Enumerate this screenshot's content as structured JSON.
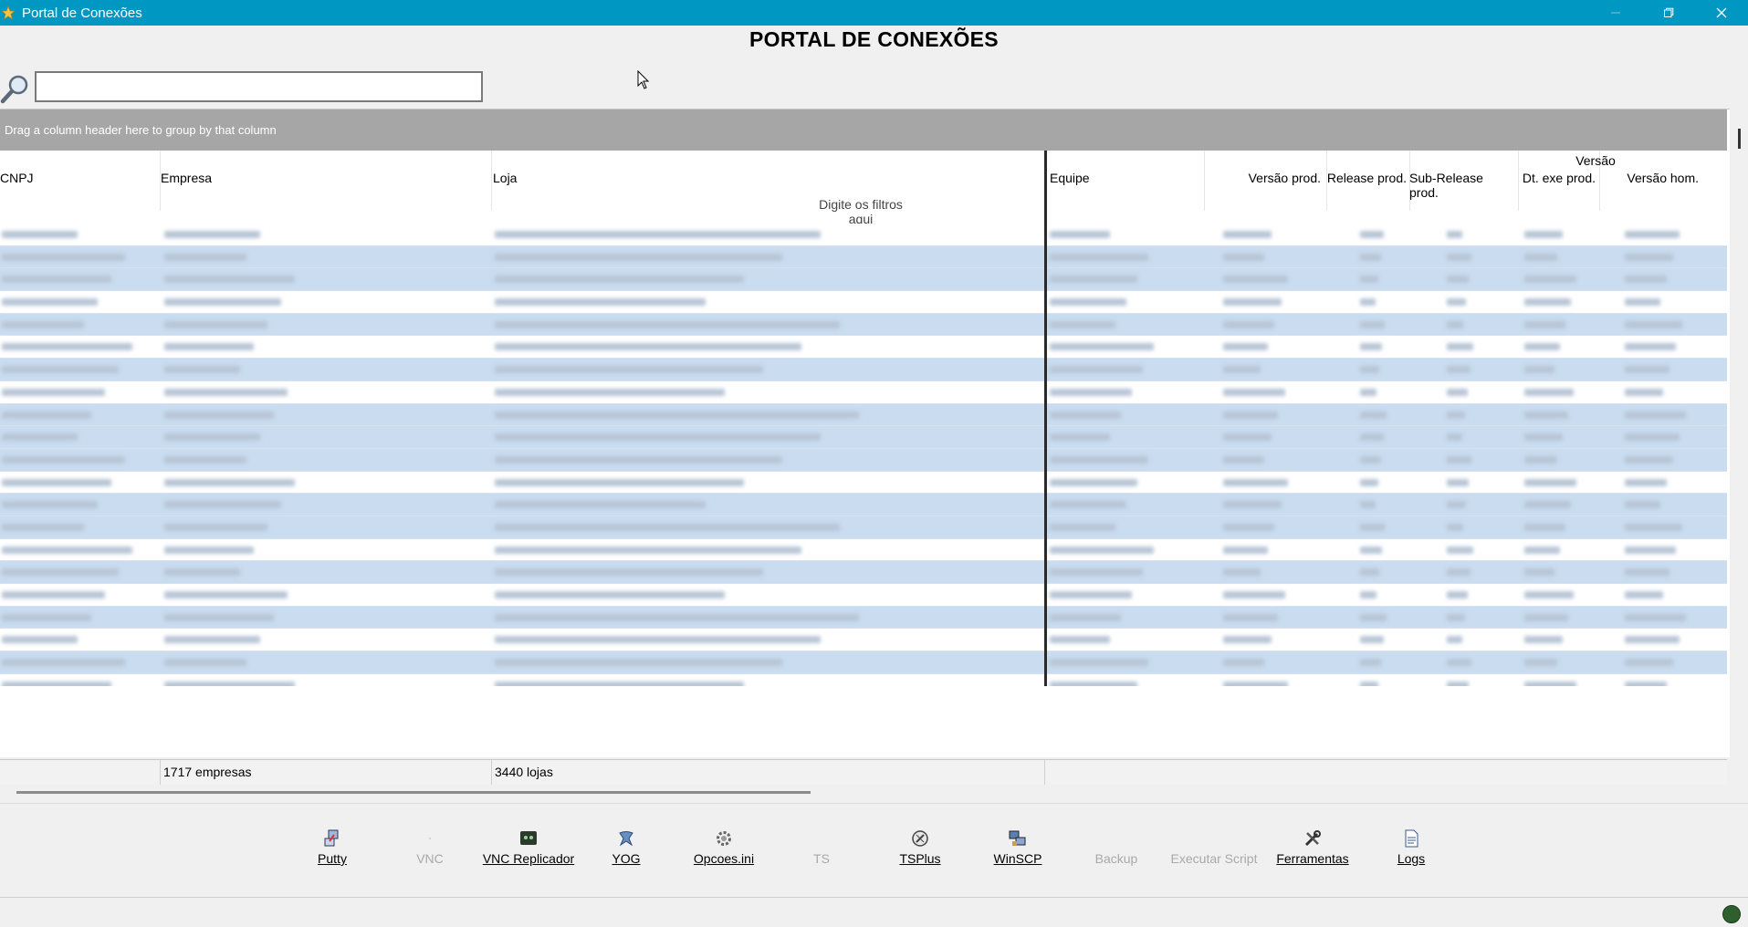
{
  "window": {
    "title": "Portal de Conexões"
  },
  "page": {
    "heading": "PORTAL DE CONEXÕES"
  },
  "search": {
    "value": "",
    "placeholder": ""
  },
  "grid": {
    "group_panel_hint": "Drag a column header here to group by that column",
    "band_label": "Versão",
    "filter_hint": "Digite os filtros aqui",
    "columns": [
      {
        "key": "cnpj",
        "label": "CNPJ"
      },
      {
        "key": "empresa",
        "label": "Empresa"
      },
      {
        "key": "loja",
        "label": "Loja"
      },
      {
        "key": "equipe",
        "label": "Equipe"
      },
      {
        "key": "versao_prod",
        "label": "Versão prod."
      },
      {
        "key": "release_prod",
        "label": "Release prod."
      },
      {
        "key": "sub_release_prod",
        "label": "Sub-Release prod."
      },
      {
        "key": "dt_exe_prod",
        "label": "Dt. exe prod."
      },
      {
        "key": "versao_hom",
        "label": "Versão hom."
      }
    ],
    "footer": {
      "empresas_count": "1717 empresas",
      "lojas_count": "3440 lojas"
    }
  },
  "toolbar": {
    "buttons": [
      {
        "label": "Putty",
        "icon": "putty-icon",
        "enabled": true
      },
      {
        "label": "VNC",
        "icon": "vnc-icon",
        "enabled": false
      },
      {
        "label": "VNC Replicador",
        "icon": "vnc-replicador-icon",
        "enabled": true
      },
      {
        "label": "YOG",
        "icon": "yog-icon",
        "enabled": true
      },
      {
        "label": "Opcoes.ini",
        "icon": "gear-icon",
        "enabled": true
      },
      {
        "label": "TS",
        "icon": "ts-icon",
        "enabled": false
      },
      {
        "label": "TSPlus",
        "icon": "tsplus-icon",
        "enabled": true
      },
      {
        "label": "WinSCP",
        "icon": "winscp-icon",
        "enabled": true
      },
      {
        "label": "Backup",
        "icon": "backup-icon",
        "enabled": false
      },
      {
        "label": "Executar Script",
        "icon": "script-icon",
        "enabled": false
      },
      {
        "label": "Ferramentas",
        "icon": "tools-icon",
        "enabled": true
      },
      {
        "label": "Logs",
        "icon": "logs-icon",
        "enabled": true
      }
    ]
  }
}
